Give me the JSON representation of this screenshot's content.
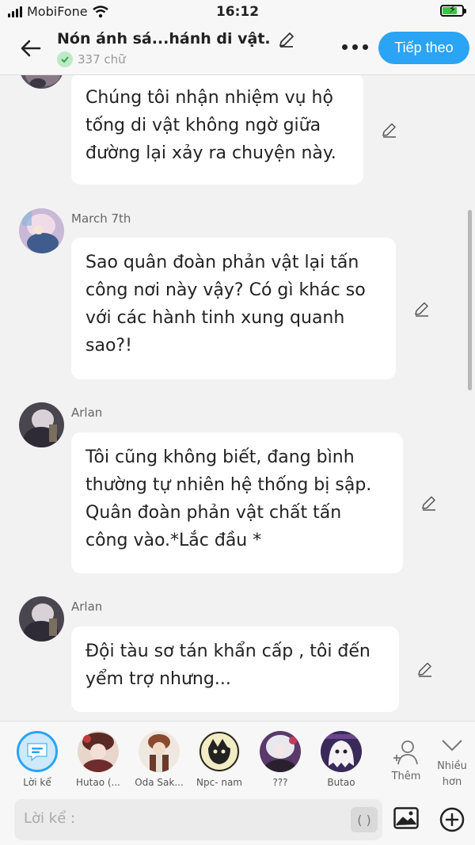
{
  "status": {
    "carrier": "MobiFone",
    "time": "16:12"
  },
  "header": {
    "title": "Nón ánh sá...hánh di vật.",
    "word_count": "337 chữ",
    "next_label": "Tiếp theo"
  },
  "messages": [
    {
      "speaker": "",
      "text": "Chúng tôi nhận nhiệm vụ hộ tống di vật không ngờ giữa đường lại xảy ra chuyện này."
    },
    {
      "speaker": "March 7th",
      "text": "Sao quân đoàn phản vật lại tấn công nơi này vậy? Có gì khác so với các hành tinh xung quanh sao?!"
    },
    {
      "speaker": "Arlan",
      "text": "Tôi cũng không biết, đang bình thường tự nhiên hệ thống bị sập. Quân đoàn phản vật chất tấn công vào.*Lắc đầu *"
    },
    {
      "speaker": "Arlan",
      "text": "Đội tàu sơ tán khẩn cấp , tôi đến yểm trợ nhưng..."
    }
  ],
  "characters": [
    {
      "label": "Lời kể"
    },
    {
      "label": "Hutao (..."
    },
    {
      "label": "Oda Sak..."
    },
    {
      "label": "Npc- nam"
    },
    {
      "label": "???"
    },
    {
      "label": "Butao"
    }
  ],
  "actions": {
    "add_label": "Thêm",
    "more_label_1": "Nhiều",
    "more_label_2": "hơn"
  },
  "input": {
    "placeholder": "Lời kể :",
    "paren": "( )"
  },
  "colors": {
    "accent": "#2aa4f4",
    "bubble": "#ffffff",
    "background": "#f2f2f2"
  }
}
